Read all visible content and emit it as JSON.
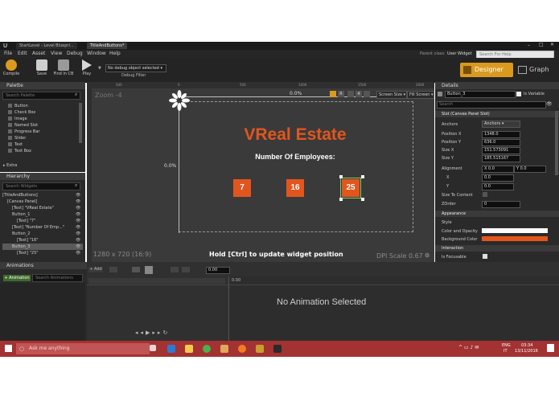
{
  "window": {
    "tabs": [
      "StartLevel - Level Bluepri...",
      "TitleAndButtons*"
    ],
    "parent_class_label": "Parent class:",
    "parent_class_value": "User Widget",
    "help_search_placeholder": "Search For Help"
  },
  "menu": [
    "File",
    "Edit",
    "Asset",
    "View",
    "Debug",
    "Window",
    "Help"
  ],
  "toolbar": {
    "compile": "Compile",
    "save": "Save",
    "find_in_cb": "Find in CB",
    "play": "Play",
    "debug_object": "No debug object selected",
    "debug_filter": "Debug Filter",
    "designer": "Designer",
    "graph": "Graph"
  },
  "palette": {
    "title": "Palette",
    "search_placeholder": "Search Palette",
    "items": [
      "Button",
      "Check Box",
      "Image",
      "Named Slot",
      "Progress Bar",
      "Slider",
      "Text",
      "Text Box"
    ],
    "extra": "Extra"
  },
  "hierarchy": {
    "title": "Hierarchy",
    "search_placeholder": "Search Widgets",
    "items": [
      "[TitleAndButtons]",
      "[Canvas Panel]",
      "[Text] \"VReal Estate\"",
      "Button_1",
      "[Text] \"7\"",
      "[Text] \"Number Of Emp...\"",
      "Button_2",
      "[Text] \"16\"",
      "Button_3",
      "[Text] \"25\""
    ]
  },
  "designer": {
    "zoom": "Zoom -4",
    "ruler_ticks": [
      "500",
      "0",
      "500",
      "1000",
      "1500",
      "2000"
    ],
    "pct_top": "0.0%",
    "pct_left": "0.0%",
    "screen_size": "Screen Size",
    "fill_screen": "Fill Screen",
    "title_text": "VReal Estate",
    "subtitle_text": "Number Of Employees:",
    "buttons": [
      "7",
      "16",
      "25"
    ],
    "resolution": "1280 x 720 (16:9)",
    "hint": "Hold [Ctrl] to update widget position",
    "dpi": "DPI Scale 0.67",
    "title_color": "#e2561e"
  },
  "details": {
    "title": "Details",
    "name_value": "Button_3",
    "is_variable": "Is Variable",
    "search_placeholder": "Search",
    "slot_section": "Slot (Canvas Panel Slot)",
    "anchors_label": "Anchors",
    "anchors_value": "Anchors",
    "props": [
      {
        "label": "Position X",
        "value": "1348.0"
      },
      {
        "label": "Position Y",
        "value": "636.0"
      },
      {
        "label": "Size X",
        "value": "151.573091"
      },
      {
        "label": "Size Y",
        "value": "185.515167"
      }
    ],
    "alignment_label": "Alignment",
    "alignment_x": "0.0",
    "alignment_y": "0.0",
    "x_label": "X",
    "x_value": "0.0",
    "y_label": "Y",
    "y_value": "0.0",
    "size_to_content": "Size To Content",
    "zorder_label": "ZOrder",
    "zorder_value": "0",
    "appearance": "Appearance",
    "style": "Style",
    "color_opacity": "Color and Opacity",
    "background_color": "Background Color",
    "interaction": "Interaction",
    "is_focusable": "Is Focusable",
    "background_color_value": "#e2561e"
  },
  "animations": {
    "title": "Animations",
    "add_button": "+ Animation",
    "search_placeholder": "Search Animations",
    "time_value": "0.00",
    "timeline_start": "0.00",
    "empty_message": "No Animation Selected",
    "add_label": "+ Add"
  },
  "taskbar": {
    "search_placeholder": "Ask me anything",
    "lang": "ENG",
    "region": "IT",
    "time": "03:34",
    "date": "13/11/2016"
  }
}
